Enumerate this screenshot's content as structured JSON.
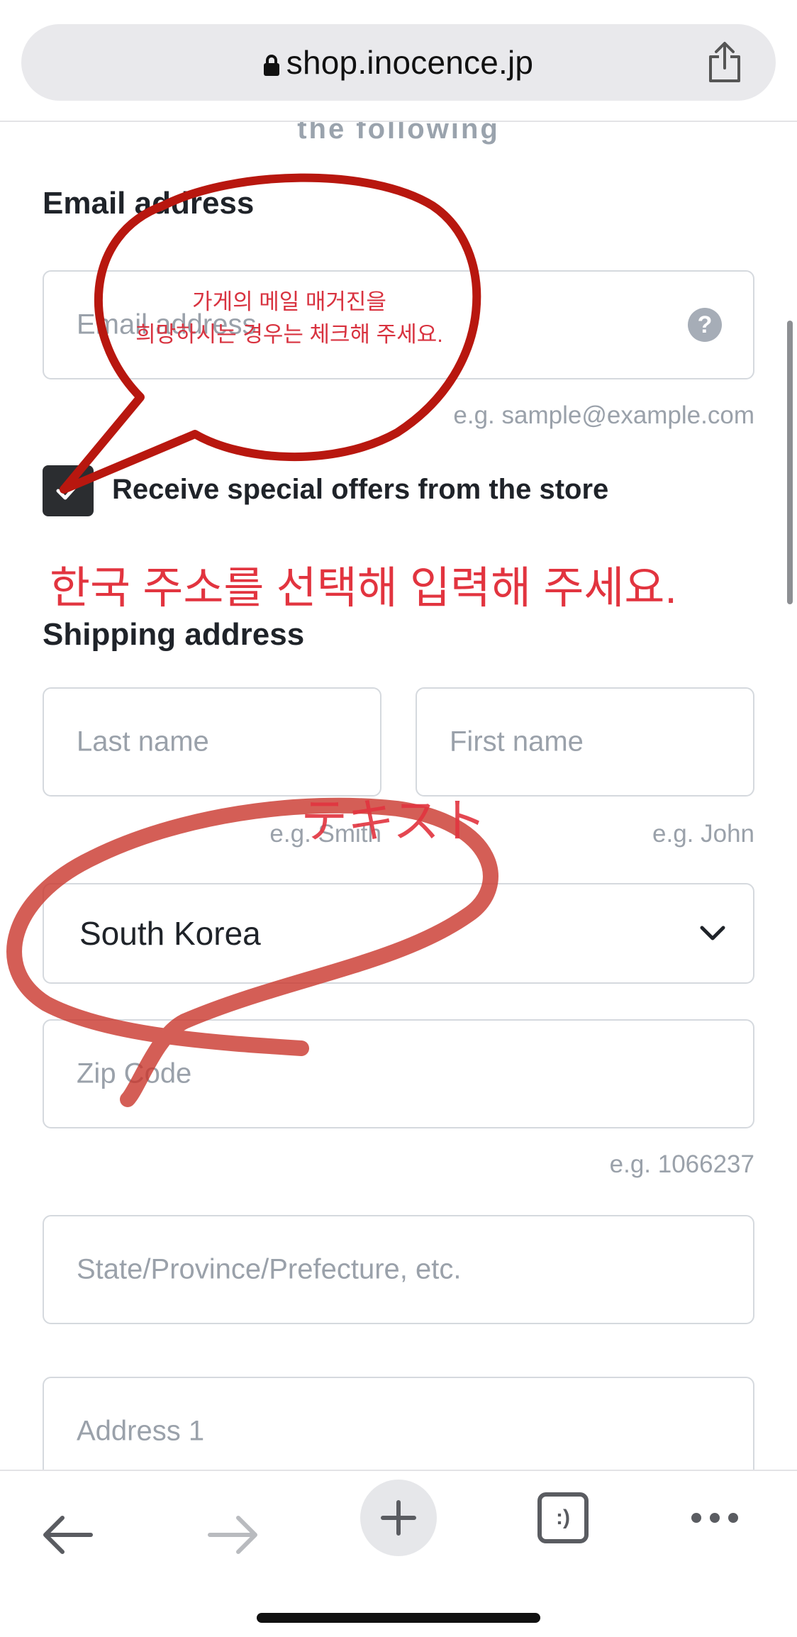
{
  "browser": {
    "url": "shop.inocence.jp",
    "lock_icon": "lock-icon",
    "share_icon": "share-icon"
  },
  "form": {
    "intro_fragment": "the following",
    "email": {
      "label": "Email address",
      "placeholder": "Email address",
      "help_symbol": "?",
      "hint": "e.g. sample@example.com"
    },
    "newsletter": {
      "label": "Receive special offers from the store",
      "checked": true
    },
    "shipping": {
      "label": "Shipping address",
      "last_name": {
        "placeholder": "Last name",
        "hint": "e.g. Smith"
      },
      "first_name": {
        "placeholder": "First name",
        "hint": "e.g. John"
      },
      "country": {
        "value": "South Korea"
      },
      "zip": {
        "placeholder": "Zip Code",
        "hint": "e.g. 1066237"
      },
      "state": {
        "placeholder": "State/Province/Prefecture, etc."
      },
      "address1": {
        "placeholder": "Address 1"
      }
    }
  },
  "annotations": {
    "bubble_line1": "가게의 메일 매거진을",
    "bubble_line2": "희망하시는 경우는 체크해 주세요.",
    "korean_instruction": "한국 주소를 선택해 입력해 주세요.",
    "japanese_text": "テキスト",
    "color": "#e2343f"
  },
  "toolbar": {
    "back_icon": "back-arrow-icon",
    "forward_icon": "forward-arrow-icon",
    "new_tab_icon": "plus-icon",
    "tabs_icon": "tabs-icon",
    "tabs_glyph": ":)",
    "more_icon": "more-icon"
  }
}
